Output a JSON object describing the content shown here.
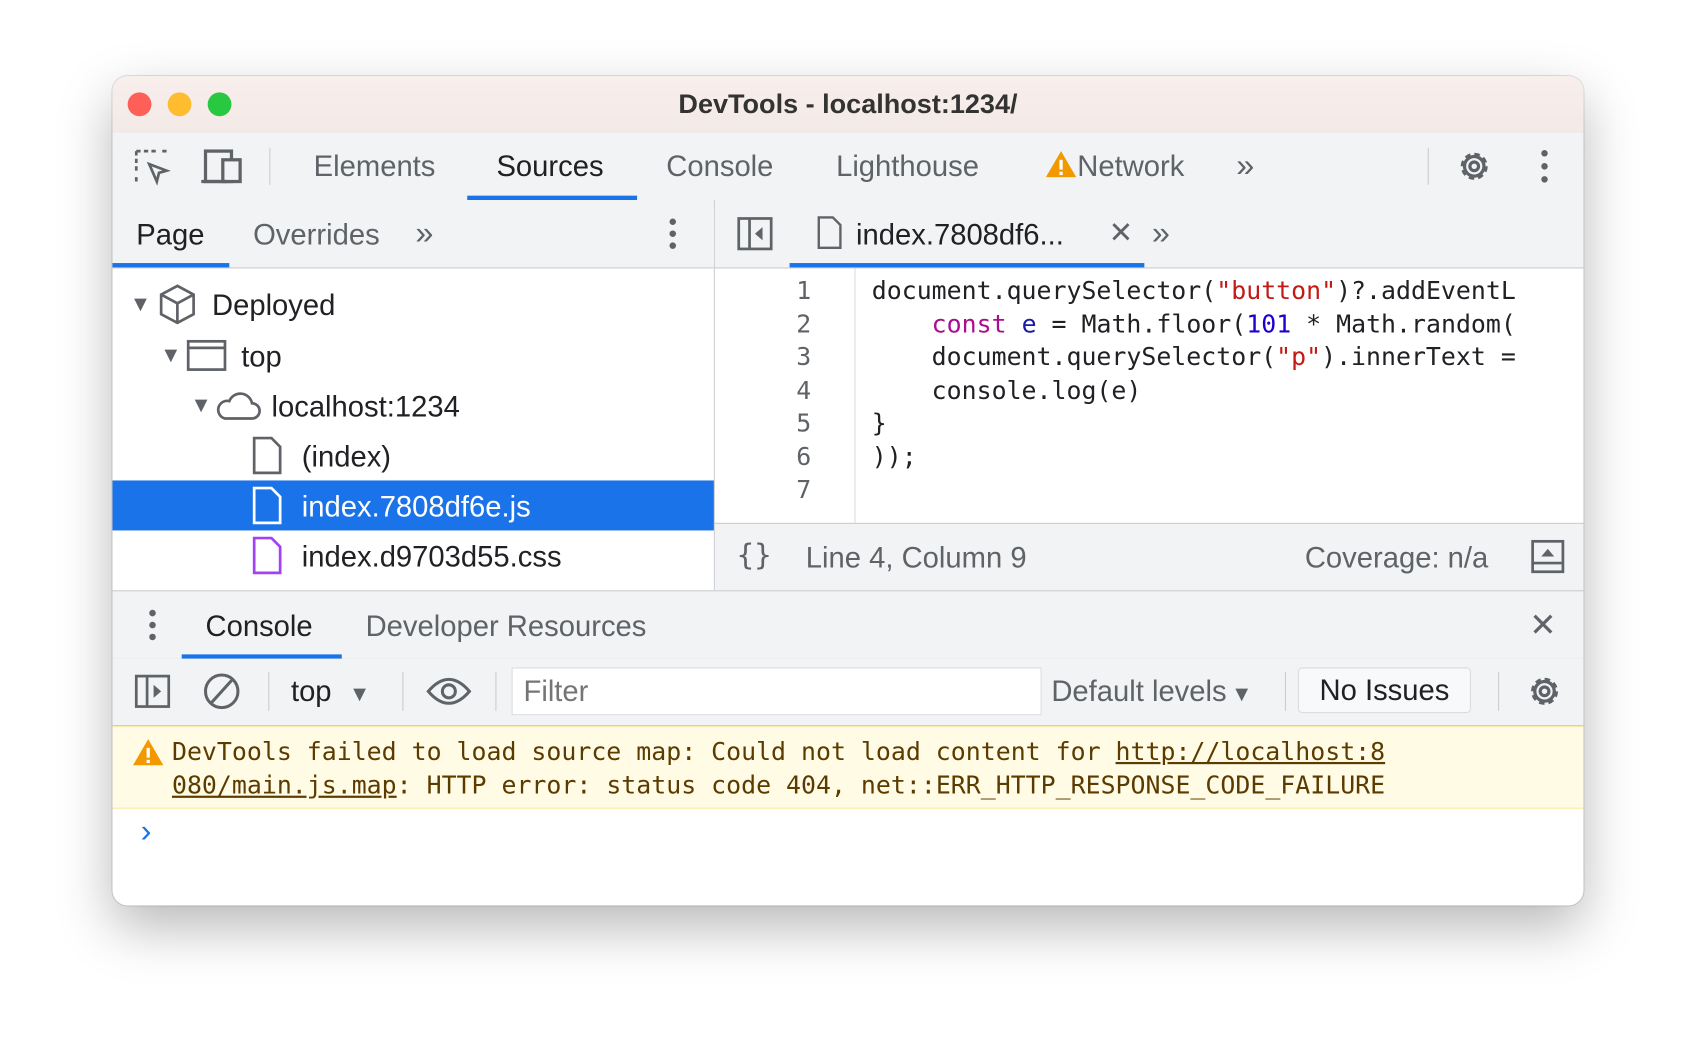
{
  "window": {
    "title": "DevTools - localhost:1234/",
    "traffic_lights": [
      "#fe5f57",
      "#febc2e",
      "#28c840"
    ]
  },
  "main_tabs": {
    "items": [
      {
        "label": "Elements"
      },
      {
        "label": "Sources",
        "active": true
      },
      {
        "label": "Console"
      },
      {
        "label": "Lighthouse"
      },
      {
        "label": "Network",
        "warning": true
      }
    ],
    "more": "more-tabs-icon"
  },
  "navigator": {
    "tabs": [
      {
        "label": "Page",
        "active": true
      },
      {
        "label": "Overrides"
      }
    ],
    "tree": [
      {
        "label": "Deployed",
        "icon": "package-icon",
        "expanded": true
      },
      {
        "label": "top",
        "icon": "frame-icon",
        "expanded": true
      },
      {
        "label": "localhost:1234",
        "icon": "cloud-icon",
        "expanded": true
      },
      {
        "label": "(index)",
        "icon": "file-icon"
      },
      {
        "label": "index.7808df6e.js",
        "icon": "file-icon",
        "selected": true
      },
      {
        "label": "index.d9703d55.css",
        "icon": "css-file-icon"
      }
    ]
  },
  "editor": {
    "tab_label": "index.7808df6...",
    "line_numbers": [
      "1",
      "2",
      "3",
      "4",
      "5",
      "6",
      "7"
    ],
    "lines": [
      [
        {
          "t": "document.querySelector("
        },
        {
          "t": "\"button\"",
          "c": "st"
        },
        {
          "t": ")?.addEventL"
        }
      ],
      [
        {
          "t": "    "
        },
        {
          "t": "const",
          "c": "kw"
        },
        {
          "t": " "
        },
        {
          "t": "e",
          "c": "vr"
        },
        {
          "t": " = Math.floor("
        },
        {
          "t": "101",
          "c": "nm"
        },
        {
          "t": " * Math.random("
        }
      ],
      [
        {
          "t": "    document.querySelector("
        },
        {
          "t": "\"p\"",
          "c": "st"
        },
        {
          "t": ").innerText ="
        }
      ],
      [
        {
          "t": "    console.log(e)"
        }
      ],
      [
        {
          "t": "}"
        }
      ],
      [
        {
          "t": "));"
        }
      ],
      [
        {
          "t": ""
        }
      ]
    ],
    "status": {
      "position": "Line 4, Column 9",
      "coverage": "Coverage: n/a"
    }
  },
  "drawer": {
    "tabs": [
      {
        "label": "Console",
        "active": true
      },
      {
        "label": "Developer Resources"
      }
    ],
    "toolbar": {
      "context": "top",
      "filter_placeholder": "Filter",
      "levels": "Default levels",
      "issues": "No Issues"
    },
    "messages": [
      {
        "level": "warning",
        "text_before": "DevTools failed to load source map: Could not load content for ",
        "link_line1": "http://localhost:8",
        "link_line2": "080/main.js.map",
        "text_after": ": HTTP error: status code 404, net::ERR_HTTP_RESPONSE_CODE_FAILURE"
      }
    ],
    "prompt": "›"
  },
  "colors": {
    "accent": "#1a73e8",
    "warning_bg": "#fffbe5",
    "warning_text": "#5c3b00",
    "warning_icon": "#f29900"
  }
}
